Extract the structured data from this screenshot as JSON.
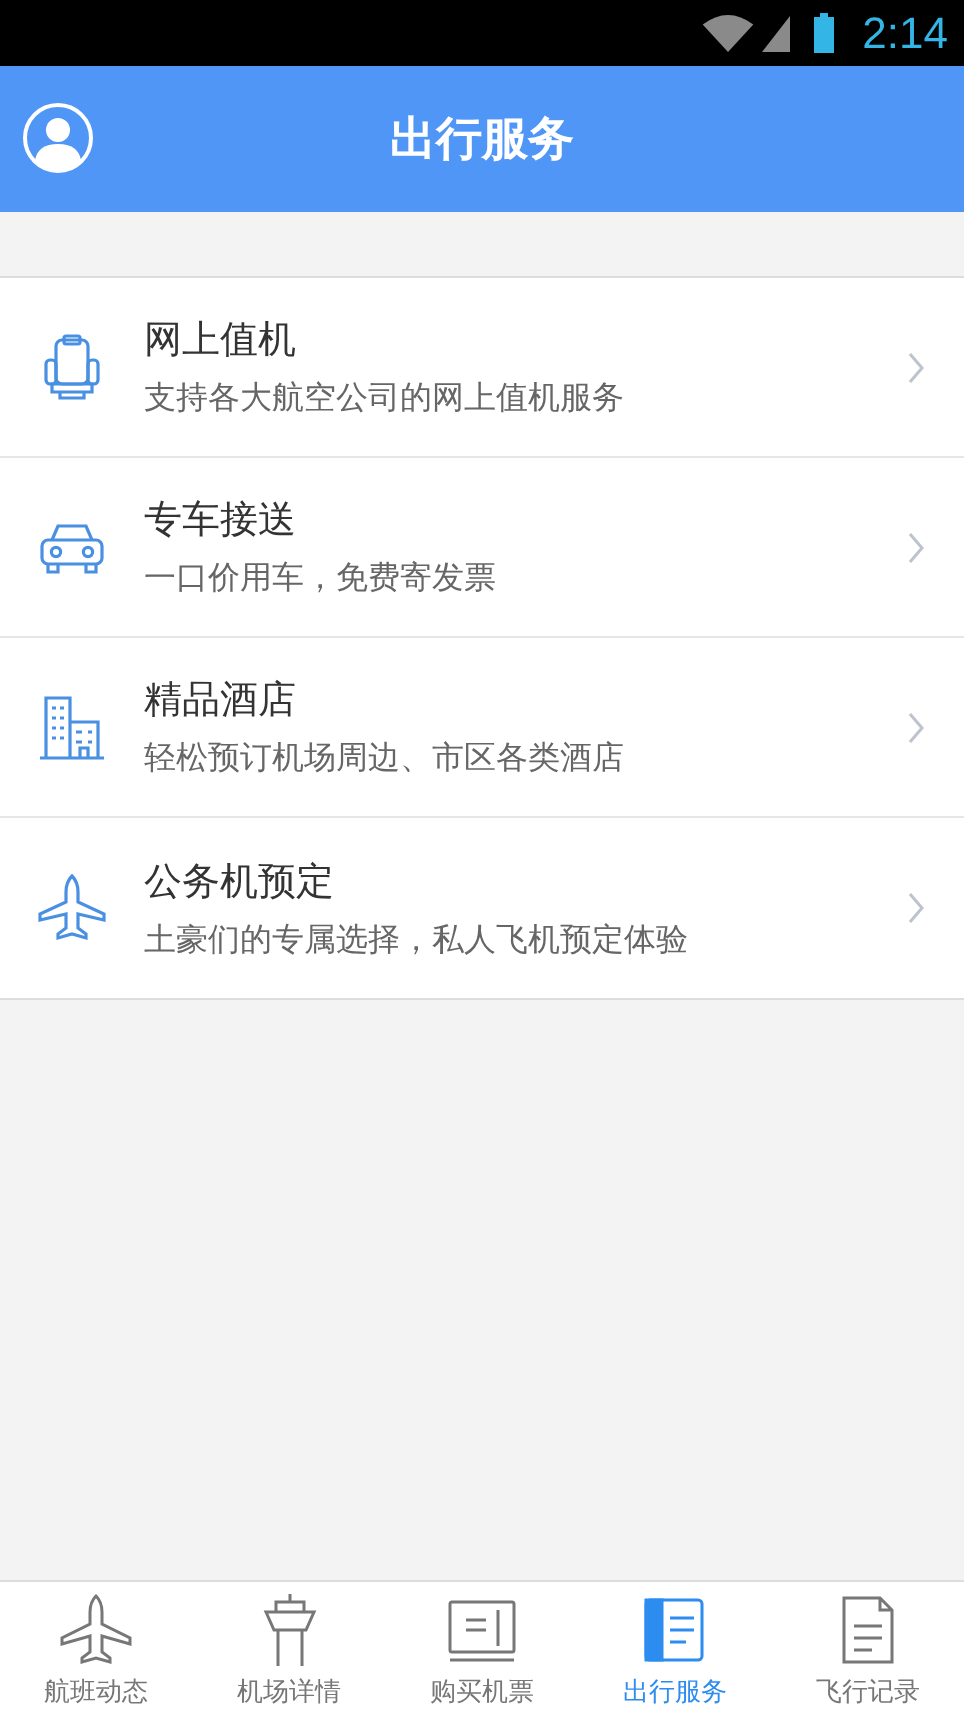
{
  "status_bar": {
    "time": "2:14"
  },
  "header": {
    "title": "出行服务"
  },
  "services": [
    {
      "kind": "seat",
      "title": "网上值机",
      "subtitle": "支持各大航空公司的网上值机服务"
    },
    {
      "kind": "car",
      "title": "专车接送",
      "subtitle": "一口价用车，免费寄发票"
    },
    {
      "kind": "hotel",
      "title": "精品酒店",
      "subtitle": "轻松预订机场周边、市区各类酒店"
    },
    {
      "kind": "plane",
      "title": "公务机预定",
      "subtitle": "土豪们的专属选择，私人飞机预定体验"
    }
  ],
  "tabs": [
    {
      "kind": "plane",
      "label": "航班动态",
      "selected": false
    },
    {
      "kind": "tower",
      "label": "机场详情",
      "selected": false
    },
    {
      "kind": "ticket",
      "label": "购买机票",
      "selected": false
    },
    {
      "kind": "service",
      "label": "出行服务",
      "selected": true
    },
    {
      "kind": "record",
      "label": "飞行记录",
      "selected": false
    }
  ]
}
